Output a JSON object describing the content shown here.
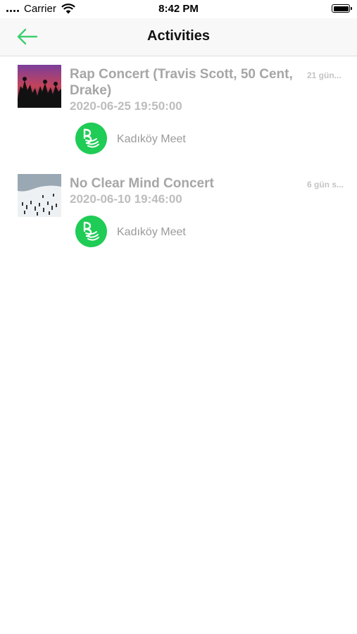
{
  "status_bar": {
    "carrier": "Carrier",
    "time": "8:42 PM",
    "icons": [
      "signal-dots-icon",
      "wifi-icon",
      "battery-icon"
    ]
  },
  "nav": {
    "title": "Activities",
    "back_icon": "arrow-left-icon",
    "accent_color": "#3ccf6e"
  },
  "activities": [
    {
      "title": "Rap Concert (Travis Scott, 50 Cent, Drake)",
      "datetime": "2020-06-25 19:50:00",
      "ago": "21 gün...",
      "venue": "Kadıköy Meet",
      "thumb": "concert-crowd-image"
    },
    {
      "title": "No Clear Mind Concert",
      "datetime": "2020-06-10 19:46:00",
      "ago": "6 gün s...",
      "venue": "Kadıköy Meet",
      "thumb": "snowy-crowd-image"
    }
  ],
  "colors": {
    "title_gray": "#a6a6a6",
    "venue_green": "#1fcc55"
  }
}
